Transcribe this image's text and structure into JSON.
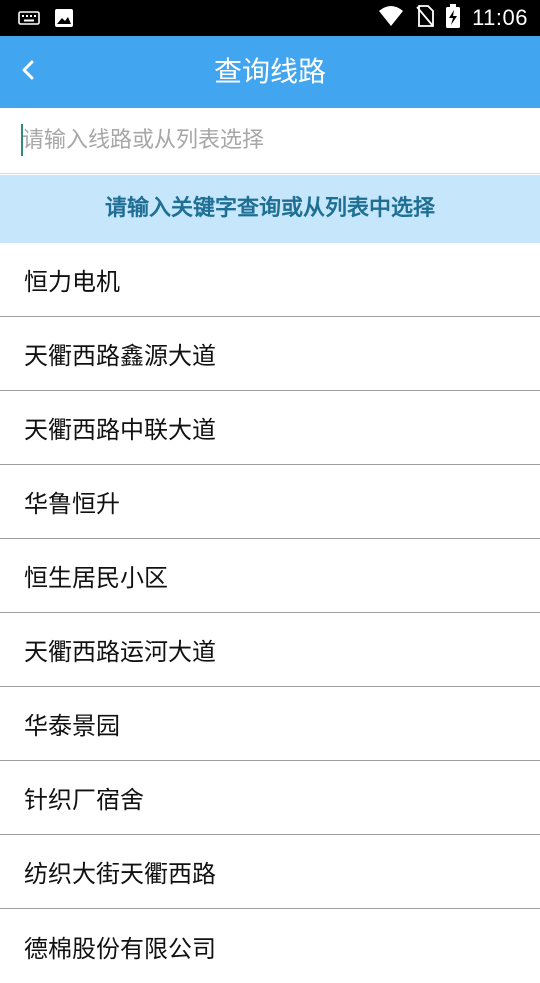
{
  "status_bar": {
    "time": "11:06",
    "icons": [
      "keyboard-icon",
      "image-icon",
      "wifi-icon",
      "no-sim-icon",
      "battery-charging-icon"
    ]
  },
  "app_bar": {
    "title": "查询线路",
    "back_icon": "chevron-left-icon"
  },
  "search": {
    "placeholder": "请输入线路或从列表选择",
    "value": ""
  },
  "hint": "请输入关键字查询或从列表中选择",
  "routes": [
    "恒力电机",
    "天衢西路鑫源大道",
    "天衢西路中联大道",
    "华鲁恒升",
    "恒生居民小区",
    "天衢西路运河大道",
    "华泰景园",
    "针织厂宿舍",
    "纺织大街天衢西路",
    "德棉股份有限公司"
  ],
  "colors": {
    "app_bar": "#42a5f0",
    "hint_bg": "#c6e7fb",
    "hint_text": "#1f6f94",
    "divider": "#9e9e9e"
  }
}
